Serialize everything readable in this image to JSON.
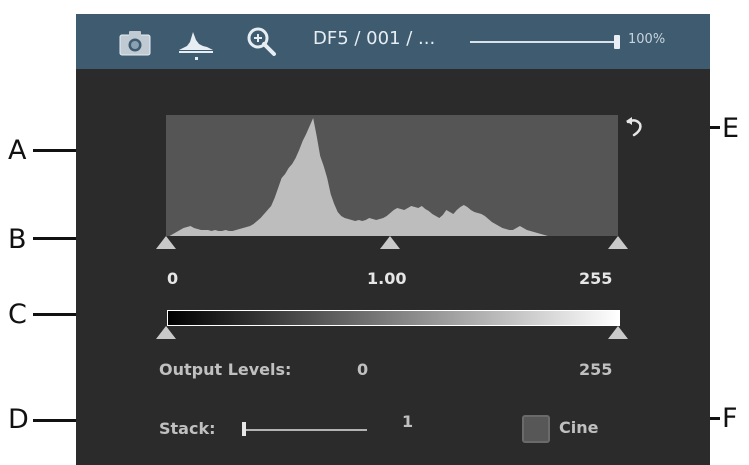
{
  "callouts": [
    "A",
    "B",
    "C",
    "D",
    "E",
    "F"
  ],
  "toolbar": {
    "title": "DF5 / 001 / ...",
    "zoom_label": "100%",
    "zoom_fraction": 1.0,
    "icons": [
      "camera-icon",
      "histogram-icon",
      "magnifier-plus-icon"
    ],
    "colors": {
      "bar": "#3f5b6f"
    }
  },
  "levels": {
    "input": {
      "black": "0",
      "gamma": "1.00",
      "white": "255"
    },
    "output": {
      "label": "Output Levels:",
      "black": "0",
      "white": "255"
    }
  },
  "stack": {
    "label": "Stack:",
    "value": "1"
  },
  "cine": {
    "label": "Cine",
    "checked": false
  },
  "reset": {
    "icon": "undo-arrow-icon"
  },
  "histogram": {
    "values": [
      0,
      0,
      2,
      4,
      6,
      8,
      9,
      10,
      8,
      7,
      6,
      6,
      6,
      5,
      6,
      5,
      5,
      6,
      5,
      5,
      6,
      7,
      8,
      9,
      10,
      12,
      15,
      18,
      22,
      26,
      30,
      38,
      48,
      58,
      62,
      68,
      72,
      78,
      86,
      95,
      102,
      110,
      118,
      100,
      80,
      70,
      58,
      42,
      32,
      24,
      20,
      18,
      17,
      16,
      15,
      16,
      15,
      16,
      18,
      17,
      16,
      17,
      18,
      20,
      23,
      26,
      28,
      27,
      26,
      28,
      30,
      29,
      28,
      30,
      27,
      25,
      22,
      20,
      18,
      21,
      26,
      24,
      22,
      26,
      29,
      31,
      29,
      26,
      24,
      23,
      22,
      20,
      17,
      14,
      12,
      10,
      8,
      7,
      6,
      6,
      8,
      10,
      8,
      6,
      5,
      4,
      3,
      2,
      1,
      0,
      0,
      0,
      0,
      0,
      0,
      0,
      0,
      0,
      0,
      0,
      0,
      0,
      0,
      0,
      0,
      0,
      0,
      0,
      0,
      0
    ],
    "max": 121
  }
}
